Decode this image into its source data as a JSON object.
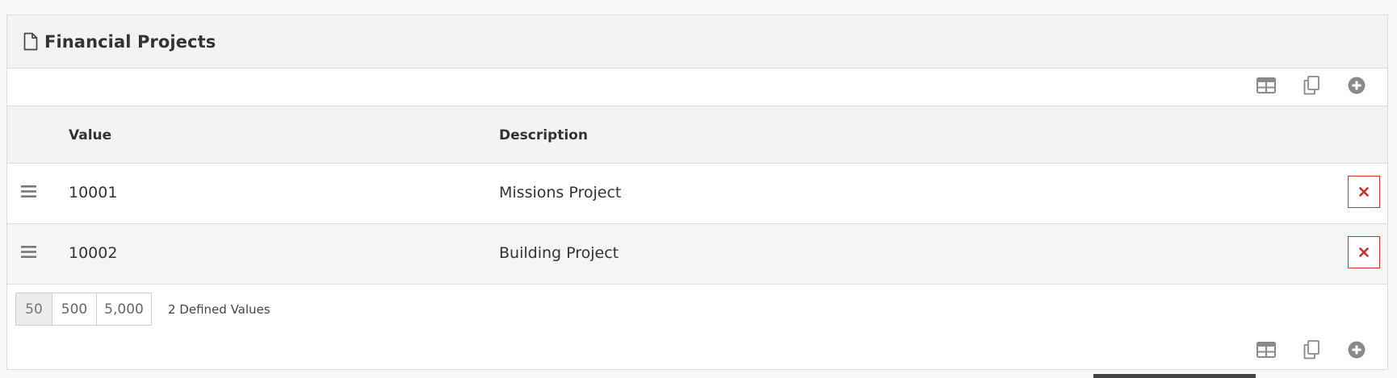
{
  "panel": {
    "title": "Financial Projects",
    "title_icon": "file-icon"
  },
  "toolbar": {
    "icons": [
      "grid-icon",
      "copy-icon",
      "add-circle-icon"
    ]
  },
  "table": {
    "columns": [
      "Value",
      "Description"
    ],
    "rows": [
      {
        "value": "10001",
        "description": "Missions Project"
      },
      {
        "value": "10002",
        "description": "Building Project"
      }
    ]
  },
  "pager": {
    "sizes": [
      "50",
      "500",
      "5,000"
    ],
    "selected": "50"
  },
  "footer": {
    "count_text": "2 Defined Values"
  },
  "colors": {
    "delete": "#c9302c",
    "icon": "#8a8a8a",
    "heading_bg": "#f3f3f3"
  }
}
